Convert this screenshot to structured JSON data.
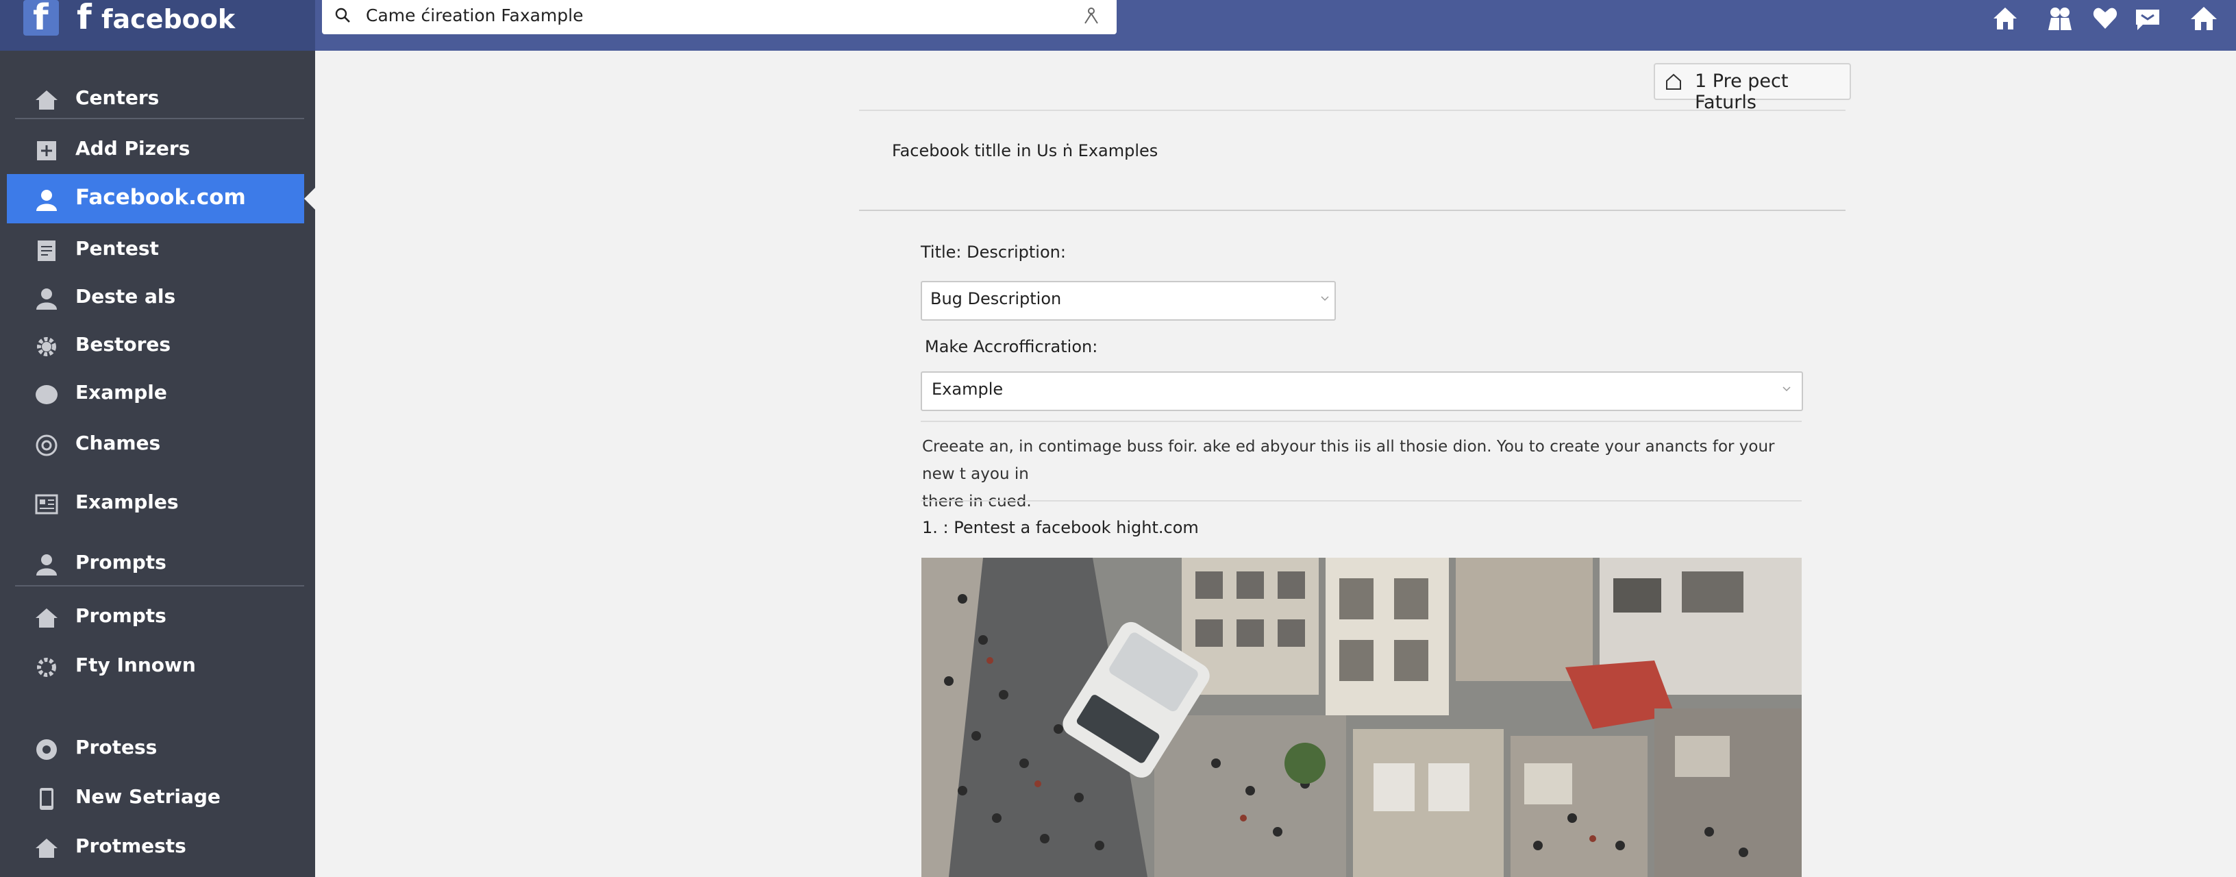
{
  "header": {
    "brand": "facebook",
    "search_value": "Came ćireation Faxample",
    "icons": [
      "home-icon",
      "friends-icon",
      "heart-icon",
      "messages-icon",
      "home-alt-icon"
    ]
  },
  "sidebar": {
    "items": [
      {
        "label": "Centers",
        "icon": "home-icon"
      },
      {
        "label": "Add Pizers",
        "icon": "add-page-icon"
      },
      {
        "label": "Facebook.com",
        "icon": "person-icon",
        "active": true
      },
      {
        "label": "Pentest",
        "icon": "document-icon"
      },
      {
        "label": "Deste als",
        "icon": "person-icon"
      },
      {
        "label": "Bestores",
        "icon": "gear-icon"
      },
      {
        "label": "Example",
        "icon": "circle-icon"
      },
      {
        "label": "Chames",
        "icon": "at-icon"
      },
      {
        "label": "Examples",
        "icon": "grid-icon"
      },
      {
        "label": "Prompts",
        "icon": "person-icon"
      },
      {
        "label": "Prompts",
        "icon": "home-icon"
      },
      {
        "label": "Fty Innown",
        "icon": "gear-icon"
      },
      {
        "label": "Protess",
        "icon": "circle-icon"
      },
      {
        "label": "New Setriage",
        "icon": "phone-icon"
      },
      {
        "label": "Protmests",
        "icon": "home-icon"
      }
    ]
  },
  "main": {
    "project_button": "1 Pre pect Faturls",
    "page_title": "Facebook titlle in Us ṅ Examples",
    "title_label": "Title: Description:",
    "title_select": "Bug Description",
    "make_label": "Make Accrofficration:",
    "make_select": "Example",
    "description_line1": "Creeate an, in contimage buss foir. ake ed abyour this iis all thosie dion. You to create your anancts for your new t ayou in",
    "description_line2": "there in cued.",
    "step": "1. : Pentest a facebook hight.com"
  },
  "colors": {
    "topbar": "#4a5b98",
    "sidebar": "#3b3f4a",
    "active": "#3d7be8",
    "page_bg": "#f2f2f2"
  }
}
